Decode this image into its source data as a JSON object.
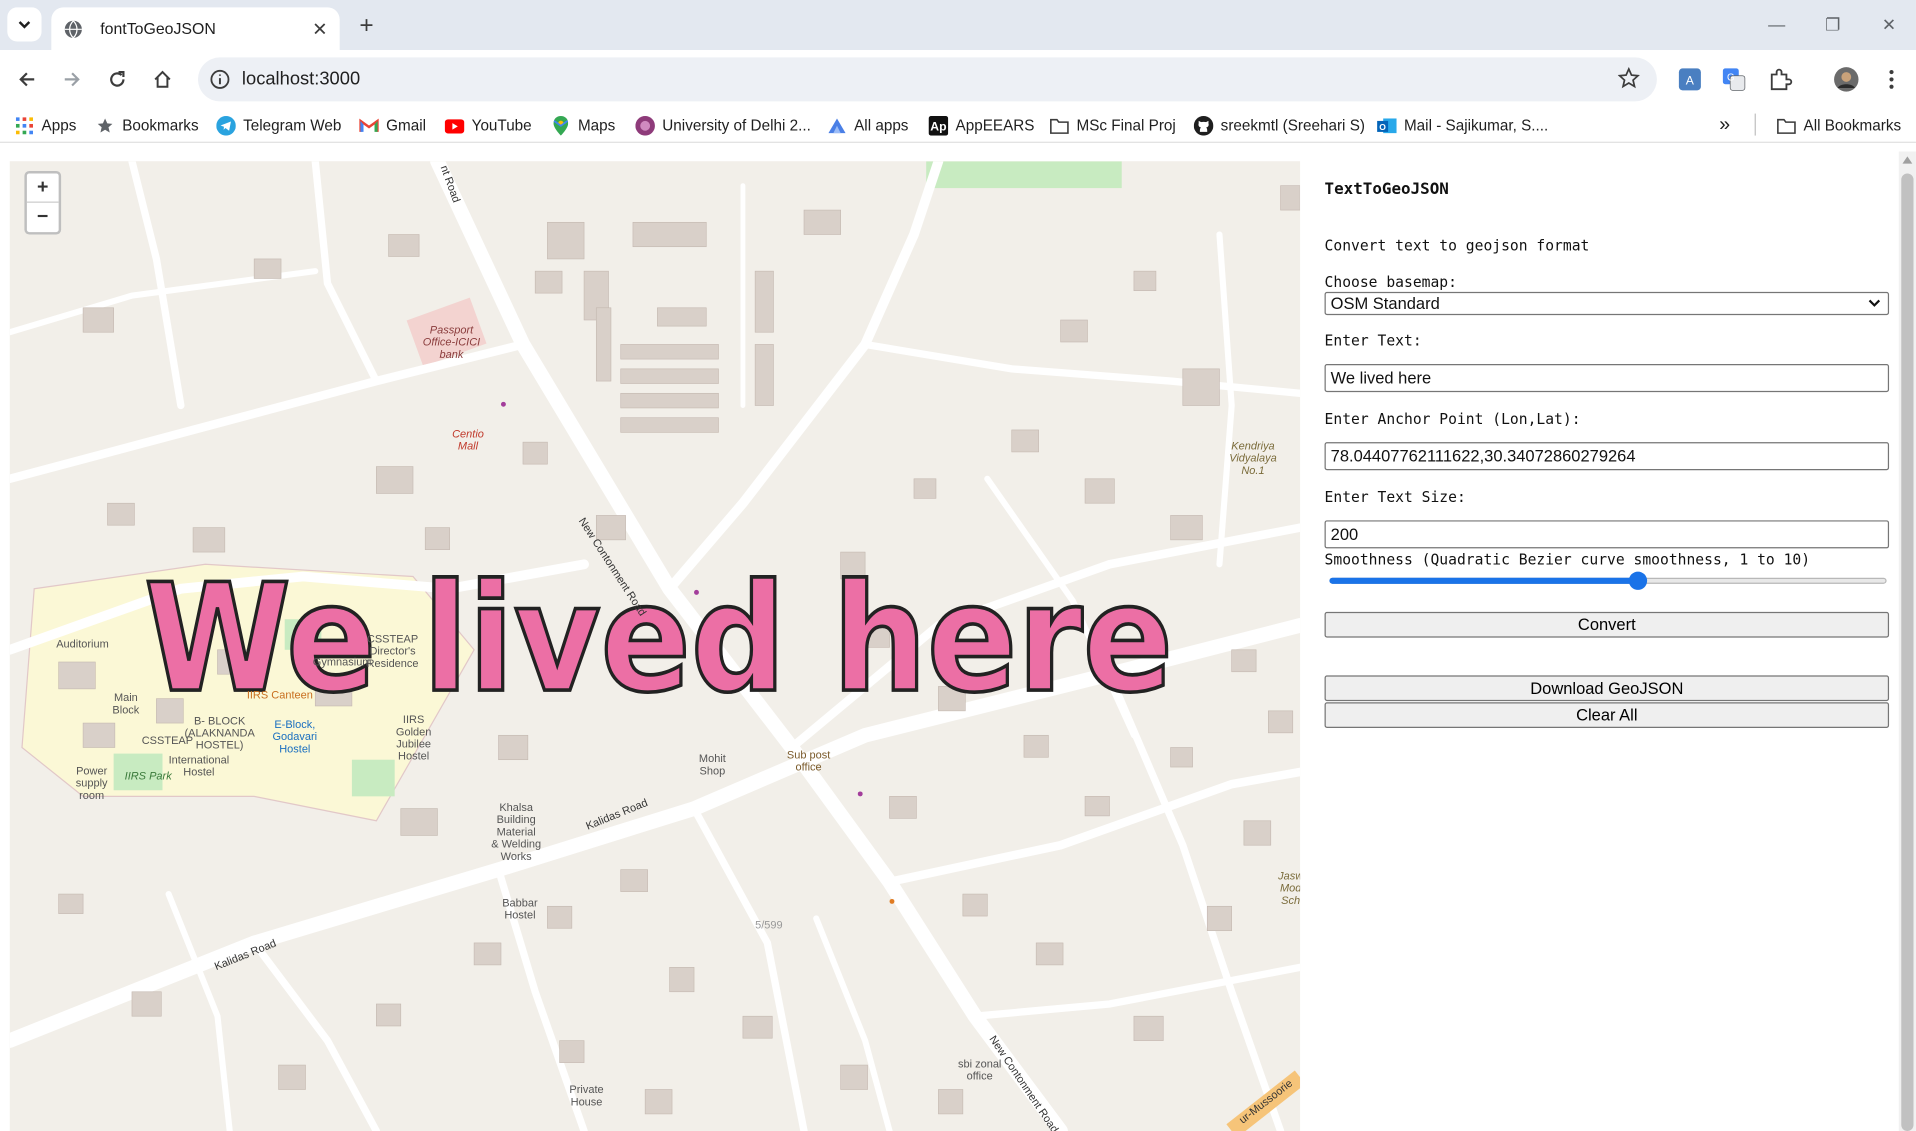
{
  "browser": {
    "tab_title": "fontToGeoJSON",
    "url": "localhost:3000",
    "bookmarks": [
      {
        "label": "Apps",
        "icon": "apps-grid-icon"
      },
      {
        "label": "Bookmarks",
        "icon": "star-icon"
      },
      {
        "label": "Telegram Web",
        "icon": "telegram-icon"
      },
      {
        "label": "Gmail",
        "icon": "gmail-icon"
      },
      {
        "label": "YouTube",
        "icon": "youtube-icon"
      },
      {
        "label": "Maps",
        "icon": "maps-pin-icon"
      },
      {
        "label": "University of Delhi 2...",
        "icon": "university-icon"
      },
      {
        "label": "All apps",
        "icon": "all-apps-icon"
      },
      {
        "label": "AppEEARS",
        "icon": "appeears-icon"
      },
      {
        "label": "MSc Final Proj",
        "icon": "folder-icon"
      },
      {
        "label": "sreekmtl (Sreehari S)",
        "icon": "github-icon"
      },
      {
        "label": "Mail - Sajikumar, S....",
        "icon": "outlook-icon"
      }
    ],
    "overflow": "»",
    "all_bookmarks": "All Bookmarks"
  },
  "map": {
    "zoom_in": "+",
    "zoom_out": "−",
    "overlay_text": "We lived here",
    "labels": {
      "passport": "Passport\nOffice-ICICI\nbank",
      "centio": "Centio\nMall",
      "kendriya": "Kendriya\nVidyalaya\nNo.1",
      "auditorium": "Auditorium",
      "main_block": "Main\nBlock",
      "csteap": "CSSTEAP",
      "bblock": "B- BLOCK\n(ALAKNANDA\nHOSTEL)",
      "international": "International\nHostel",
      "power": "Power\nsupply\nroom",
      "iirs_park": "IIRS Park",
      "iirs_canteen": "IIRS Canteen",
      "eblock": "E-Block,\nGodavari\nHostel",
      "iirs_golden": "IIRS\nGolden\nJubilee\nHostel",
      "csteap_dir": "CSSTEAP\nDirector's\nResidence",
      "gymnasium": "Gymnasium",
      "mohit": "Mohit\nShop",
      "subpost": "Sub post\noffice",
      "khalsa": "Khalsa\nBuilding\nMaterial\n& Welding\nWorks",
      "babbar": "Babbar\nHostel",
      "private": "Private\nHouse",
      "sbi": "sbi zonal\noffice",
      "jaswant": "Jasw\nMod\nSch",
      "number": "5/599",
      "new_cont_1": "New Contonment Road",
      "new_cont_2": "New Contonment Road",
      "kalidas_1": "Kalidas Road",
      "kalidas_2": "Kalidas Road",
      "nt_road": "nt Road",
      "mussoorie": "ur-Mussoorie"
    }
  },
  "panel": {
    "title": "TextToGeoJSON",
    "subtitle": "Convert text to geojson format",
    "basemap_label": "Choose basemap:",
    "basemap_value": "OSM Standard",
    "text_label": "Enter Text:",
    "text_value": "We lived here",
    "anchor_label": "Enter Anchor Point (Lon,Lat):",
    "anchor_value": "78.04407762111622,30.34072860279264",
    "size_label": "Enter Text Size:",
    "size_value": "200",
    "smooth_label": "Smoothness (Quadratic Bezier curve smoothness, 1 to 10)",
    "smooth_value": 6,
    "smooth_min": 1,
    "smooth_max": 10,
    "convert_label": "Convert",
    "download_label": "Download GeoJSON",
    "clear_label": "Clear All"
  },
  "colors": {
    "overlay_fill": "#ec6fa5",
    "slider_accent": "#1a73e8",
    "map_bg": "#f2efe9",
    "campus": "#fbf8d6"
  }
}
